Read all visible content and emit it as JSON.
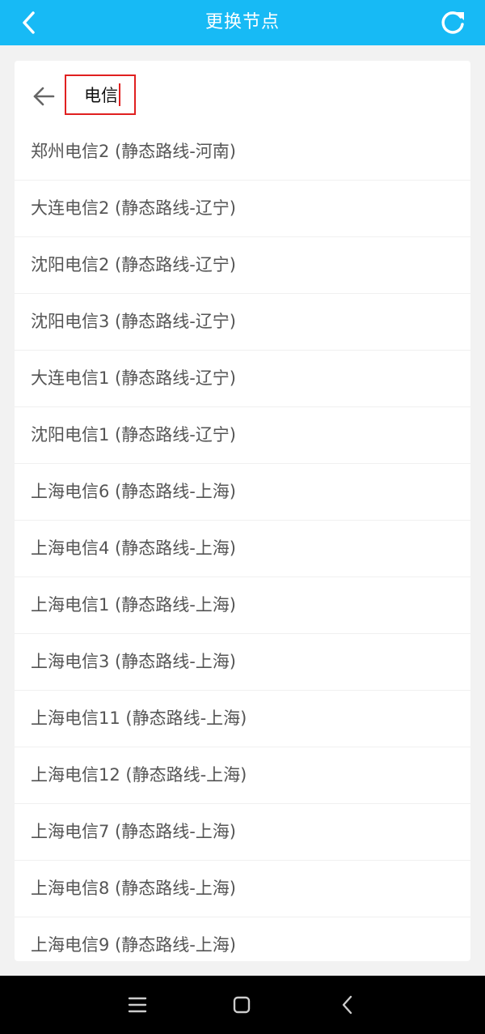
{
  "header": {
    "title": "更换节点",
    "back_icon": "chevron-left-icon",
    "refresh_icon": "refresh-icon",
    "bg_color": "#17baf5"
  },
  "search": {
    "value": "电信",
    "back_icon": "arrow-left-icon",
    "highlight_color": "#e02020"
  },
  "nodes": [
    {
      "label": "郑州电信2 (静态路线-河南)"
    },
    {
      "label": "大连电信2 (静态路线-辽宁)"
    },
    {
      "label": "沈阳电信2 (静态路线-辽宁)"
    },
    {
      "label": "沈阳电信3 (静态路线-辽宁)"
    },
    {
      "label": "大连电信1 (静态路线-辽宁)"
    },
    {
      "label": "沈阳电信1 (静态路线-辽宁)"
    },
    {
      "label": "上海电信6 (静态路线-上海)"
    },
    {
      "label": "上海电信4 (静态路线-上海)"
    },
    {
      "label": "上海电信1 (静态路线-上海)"
    },
    {
      "label": "上海电信3 (静态路线-上海)"
    },
    {
      "label": "上海电信11 (静态路线-上海)"
    },
    {
      "label": "上海电信12 (静态路线-上海)"
    },
    {
      "label": "上海电信7 (静态路线-上海)"
    },
    {
      "label": "上海电信8 (静态路线-上海)"
    },
    {
      "label": "上海电信9 (静态路线-上海)"
    }
  ],
  "system_nav": {
    "menu_icon": "menu-icon",
    "home_icon": "home-square-icon",
    "back_icon": "back-chevron-icon"
  }
}
